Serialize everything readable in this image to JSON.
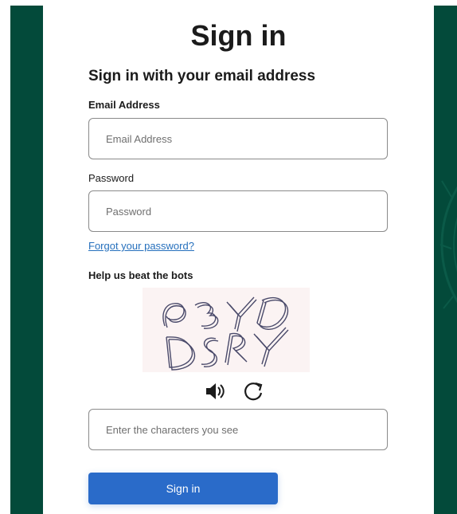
{
  "page": {
    "title": "Sign in",
    "subtitle": "Sign in with your email address"
  },
  "email": {
    "label": "Email Address",
    "placeholder": "Email Address"
  },
  "password": {
    "label": "Password",
    "placeholder": "Password"
  },
  "forgot_link": "Forgot your password?",
  "captcha": {
    "label": "Help us beat the bots",
    "input_placeholder": "Enter the characters you see",
    "audio_icon": "speaker-icon",
    "refresh_icon": "refresh-icon",
    "image_text": "P3YD DSRY"
  },
  "actions": {
    "signin_label": "Sign in"
  },
  "colors": {
    "brand_green": "#034a3a",
    "button_blue": "#2a6bc9",
    "link_blue": "#2670bd"
  }
}
